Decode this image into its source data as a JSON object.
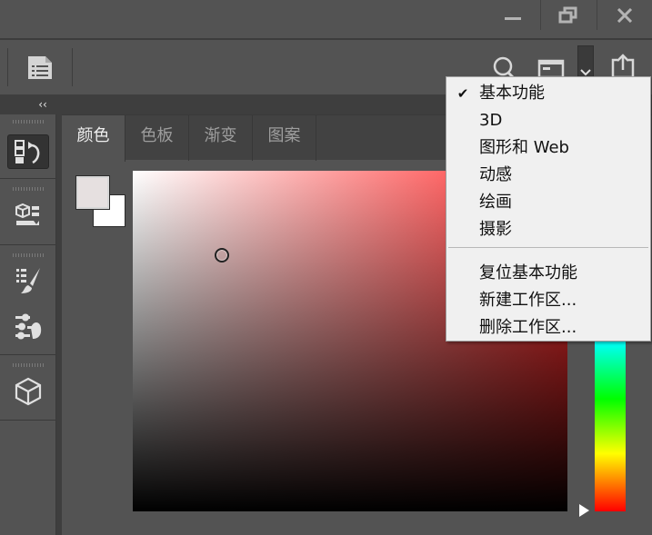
{
  "colors": {
    "app_bg": "#535353",
    "dark_bar": "#3e3e3e",
    "menu_bg": "#f0f0f0",
    "hue_base": "#ff2d2d",
    "foreground_swatch": "#e6e0e0",
    "background_swatch": "#ffffff"
  },
  "window_controls": {
    "minimize_icon": "minimize-icon",
    "restore_icon": "restore-icon",
    "close_icon": "close-icon"
  },
  "options_bar": {
    "tool_icon": "document-list-icon",
    "search_icon": "search-icon",
    "workspace_icon": "workspace-icon",
    "dropdown_icon": "chevron-down-icon",
    "share_icon": "share-icon"
  },
  "collapse_label": "‹‹",
  "toolbar": {
    "tools": [
      "history-panel-icon",
      "3d-materials-icon",
      "brush-presets-icon",
      "adjustments-icon",
      "3d-cube-icon"
    ]
  },
  "panel": {
    "tabs": [
      {
        "label": "颜色",
        "active": true
      },
      {
        "label": "色板",
        "active": false
      },
      {
        "label": "渐变",
        "active": false
      },
      {
        "label": "图案",
        "active": false
      }
    ],
    "hue_marker_level": 1.0
  },
  "workspace_menu": {
    "items": [
      {
        "label": "基本功能",
        "checked": true
      },
      {
        "label": "3D",
        "checked": false
      },
      {
        "label": "图形和 Web",
        "checked": false
      },
      {
        "label": "动感",
        "checked": false
      },
      {
        "label": "绘画",
        "checked": false
      },
      {
        "label": "摄影",
        "checked": false
      }
    ],
    "actions": [
      {
        "label": "复位基本功能"
      },
      {
        "label": "新建工作区..."
      },
      {
        "label": "删除工作区..."
      }
    ]
  }
}
